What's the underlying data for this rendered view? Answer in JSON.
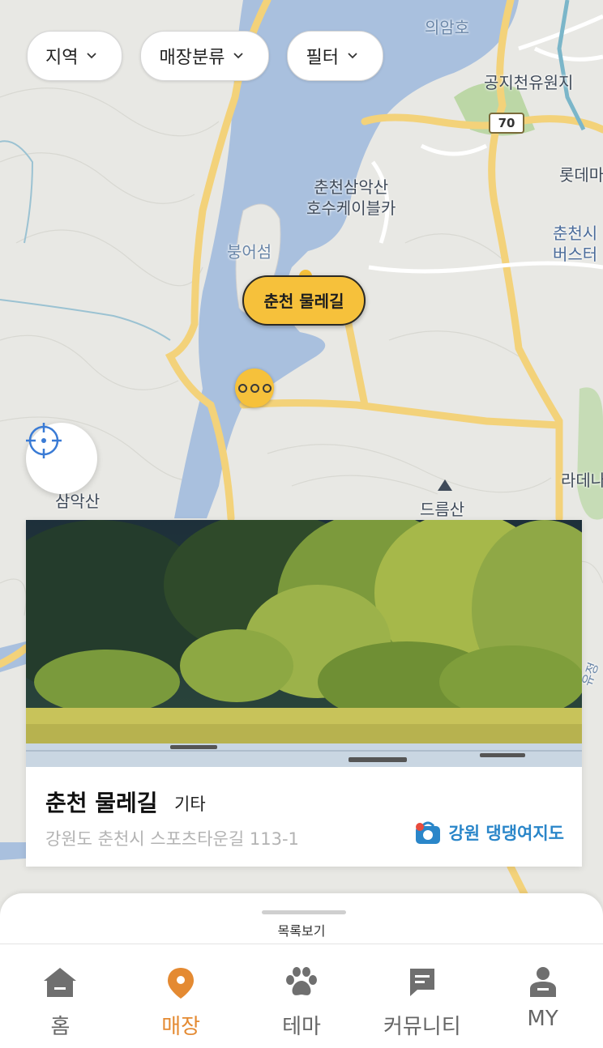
{
  "filters": [
    {
      "label": "지역"
    },
    {
      "label": "매장분류"
    },
    {
      "label": "필터"
    }
  ],
  "map": {
    "labels": {
      "uiamho": "의암호",
      "gongji": "공지천유원지",
      "lotte": "롯데마",
      "samaksan_cable_1": "춘천삼악산",
      "samaksan_cable_2": "호수케이블카",
      "bungeoseom": "붕어섬",
      "terminal_1": "춘천시",
      "terminal_2": "버스터",
      "radenos": "라데나",
      "samaksan": "삼악산",
      "deureumsan": "드름산",
      "side_road": "유정",
      "route_label": "70"
    },
    "selected_marker": "춘천 물레길",
    "cluster_icon": "more-dots-icon"
  },
  "card": {
    "title": "춘천 물레길",
    "category": "기타",
    "address": "강원도 춘천시 스포츠타운길 113-1",
    "brand": "강원 댕댕여지도"
  },
  "sheet": {
    "list_label": "목록보기"
  },
  "tabs": [
    {
      "label": "홈",
      "icon": "home-icon",
      "active": false
    },
    {
      "label": "매장",
      "icon": "location-pin-icon",
      "active": true
    },
    {
      "label": "테마",
      "icon": "paw-icon",
      "active": false
    },
    {
      "label": "커뮤니티",
      "icon": "chat-icon",
      "active": false
    },
    {
      "label": "MY",
      "icon": "person-icon",
      "active": false
    }
  ],
  "colors": {
    "accent": "#e48a32",
    "marker": "#f6c13b",
    "brand": "#2a86c9",
    "water": "#a9c0de",
    "road": "#f3d27a"
  }
}
